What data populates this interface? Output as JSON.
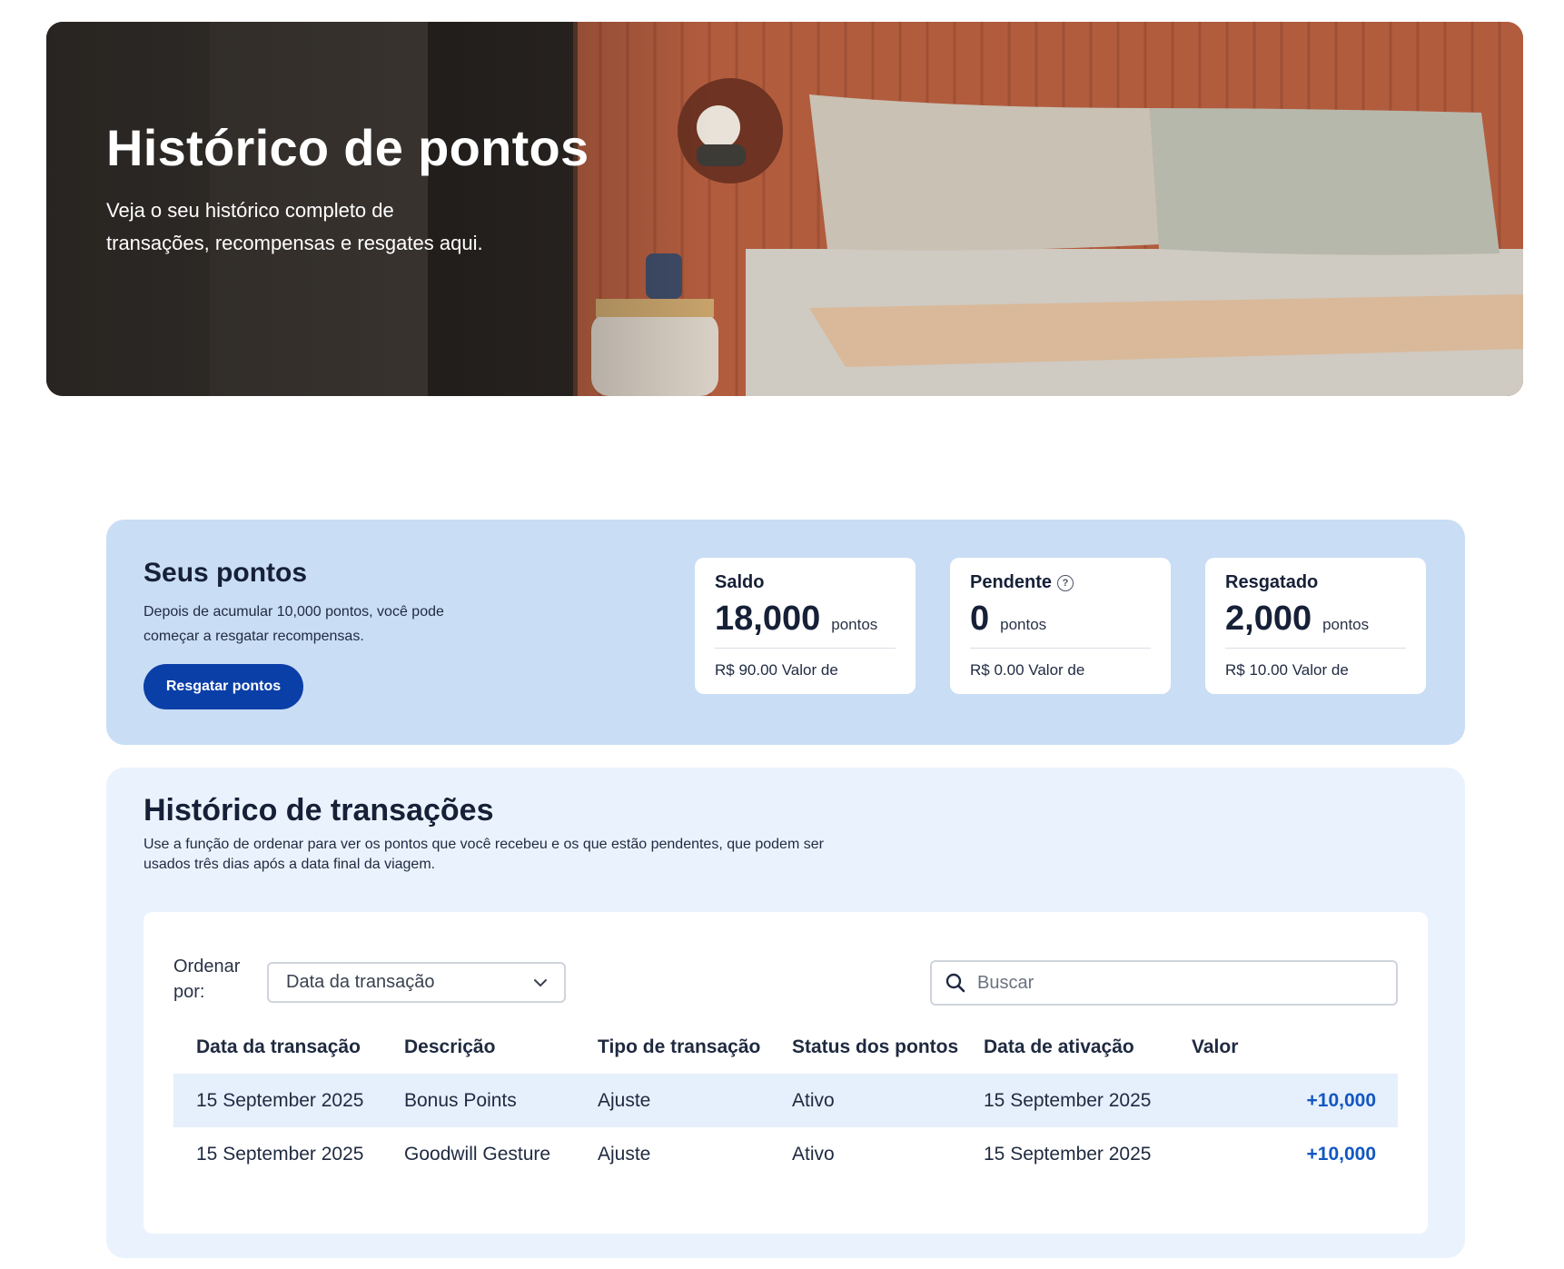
{
  "hero": {
    "title": "Histórico de pontos",
    "subtitle": "Veja o seu histórico completo de transações, recompensas e resgates aqui."
  },
  "points": {
    "title": "Seus pontos",
    "description": "Depois de acumular 10,000 pontos, você pode começar a resgatar recompensas.",
    "redeem_label": "Resgatar pontos",
    "cards": [
      {
        "label": "Saldo",
        "value": "18,000",
        "unit": "pontos",
        "money": "R$ 90.00 Valor de"
      },
      {
        "label": "Pendente",
        "value": "0",
        "unit": "pontos",
        "money": "R$ 0.00 Valor de",
        "help_glyph": "?"
      },
      {
        "label": "Resgatado",
        "value": "2,000",
        "unit": "pontos",
        "money": "R$ 10.00 Valor de"
      }
    ]
  },
  "transactions": {
    "title": "Histórico de transações",
    "description": "Use a função de ordenar para ver os pontos que você recebeu e os que estão pendentes, que podem ser usados três dias após a data final da viagem.",
    "sort_label": "Ordenar por:",
    "sort_selected": "Data da transação",
    "search_placeholder": "Buscar",
    "columns": [
      "Data da transação",
      "Descrição",
      "Tipo de transação",
      "Status dos pontos",
      "Data de ativação",
      "Valor"
    ],
    "rows": [
      [
        "15 September 2025",
        "Bonus Points",
        "Ajuste",
        "Ativo",
        "15 September 2025",
        "+10,000"
      ],
      [
        "15 September 2025",
        "Goodwill Gesture",
        "Ajuste",
        "Ativo",
        "15 September 2025",
        "+10,000"
      ]
    ]
  },
  "colors": {
    "accent": "#0b3fa8",
    "points_panel_bg": "#c9ddf5",
    "transactions_panel_bg": "#eaf3fd",
    "amount_positive": "#1257c2"
  },
  "icons": {
    "help": "help-circle-icon",
    "sort_chevron": "chevron-down-icon",
    "search": "search-icon"
  }
}
